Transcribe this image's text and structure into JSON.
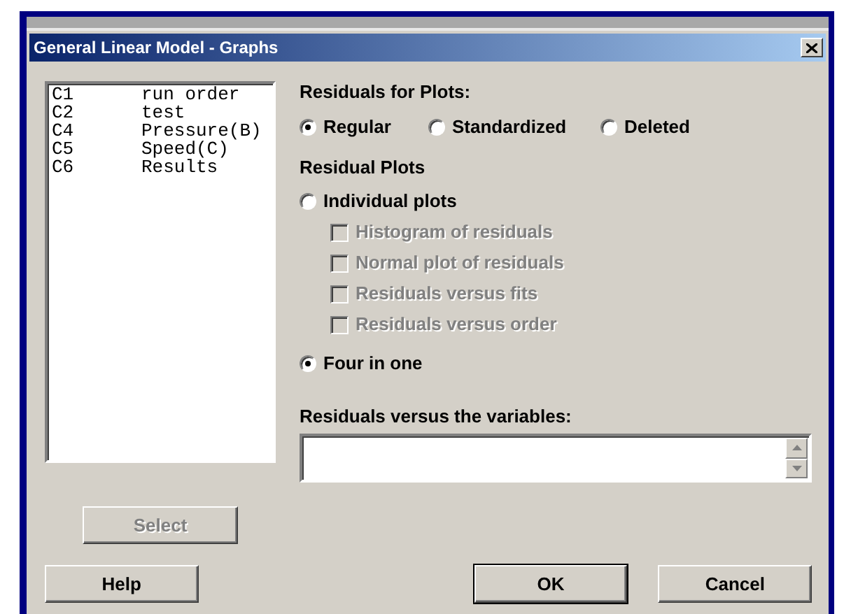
{
  "window": {
    "title": "General Linear Model - Graphs"
  },
  "variables": [
    {
      "column": "C1",
      "name": "run order"
    },
    {
      "column": "C2",
      "name": "test"
    },
    {
      "column": "C4",
      "name": "Pressure(B)"
    },
    {
      "column": "C5",
      "name": "Speed(C)"
    },
    {
      "column": "C6",
      "name": "Results"
    }
  ],
  "select_button": {
    "label": "Select",
    "disabled": true
  },
  "residuals_for_plots": {
    "label": "Residuals for Plots:",
    "options": [
      {
        "label": "Regular",
        "selected": true
      },
      {
        "label": "Standardized",
        "selected": false
      },
      {
        "label": "Deleted",
        "selected": false
      }
    ]
  },
  "residual_plots": {
    "label": "Residual Plots",
    "options": [
      {
        "label": "Individual plots",
        "selected": false,
        "checkboxes": [
          {
            "label": "Histogram of residuals",
            "checked": false,
            "disabled": true
          },
          {
            "label": "Normal plot of residuals",
            "checked": false,
            "disabled": true
          },
          {
            "label": "Residuals versus fits",
            "checked": false,
            "disabled": true
          },
          {
            "label": "Residuals versus order",
            "checked": false,
            "disabled": true
          }
        ]
      },
      {
        "label": "Four in one",
        "selected": true
      }
    ]
  },
  "variables_field": {
    "label": "Residuals versus the variables:"
  },
  "buttons": [
    {
      "label": "Help",
      "default": false
    },
    {
      "label": "OK",
      "default": true
    },
    {
      "label": "Cancel",
      "default": false
    }
  ]
}
